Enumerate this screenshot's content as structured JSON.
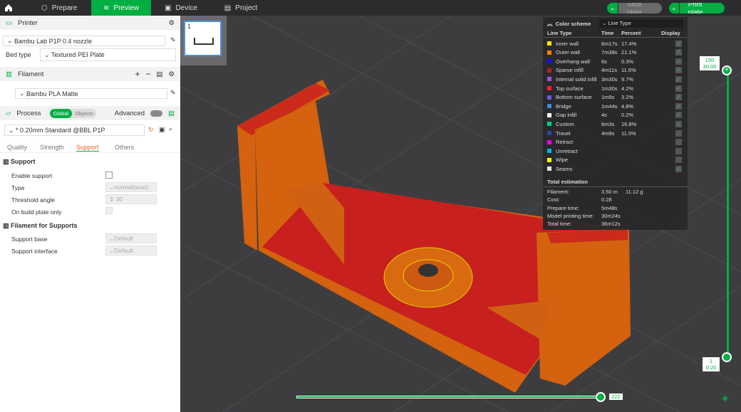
{
  "tabs": [
    {
      "label": "Prepare",
      "icon": "cube-icon"
    },
    {
      "label": "Preview",
      "icon": "layers-icon",
      "active": true
    },
    {
      "label": "Device",
      "icon": "device-icon"
    },
    {
      "label": "Project",
      "icon": "project-icon"
    }
  ],
  "actions": {
    "slice": "Slice plate",
    "print": "Print plate"
  },
  "printer": {
    "title": "Printer",
    "name": "Bambu Lab P1P 0.4 nozzle",
    "bed_label": "Bed type",
    "bed": "Textured PEI Plate"
  },
  "filament": {
    "title": "Filament",
    "name": "Bambu PLA Matte"
  },
  "process": {
    "title": "Process",
    "global": "Global",
    "objects": "Objects",
    "advanced": "Advanced",
    "preset": "* 0.20mm Standard @BBL P1P",
    "tabs": [
      "Quality",
      "Strength",
      "Support",
      "Others"
    ],
    "active_tab": "Support"
  },
  "support": {
    "title": "Support",
    "enable": "Enable support",
    "type_label": "Type",
    "type": "normal(auto)",
    "threshold_label": "Threshold angle",
    "threshold": "30",
    "build_plate": "On build plate only",
    "fil_title": "Filament for Supports",
    "base_label": "Support base",
    "base": "Default",
    "iface_label": "Support interface",
    "iface": "Default"
  },
  "plate": {
    "number": "1"
  },
  "legend": {
    "title": "Color scheme",
    "scheme": "Line Type",
    "headers": [
      "Line Type",
      "Time",
      "Percent",
      "Display"
    ],
    "rows": [
      {
        "name": "Inner wall",
        "time": "6m17s",
        "pct": "17.4%",
        "color": "#ffe600",
        "on": true
      },
      {
        "name": "Outer wall",
        "time": "7m38s",
        "pct": "21.1%",
        "color": "#ff7f00",
        "on": true
      },
      {
        "name": "Overhang wall",
        "time": "6s",
        "pct": "0.3%",
        "color": "#1010ff",
        "on": true
      },
      {
        "name": "Sparse infill",
        "time": "4m11s",
        "pct": "11.6%",
        "color": "#b41e1e",
        "on": true
      },
      {
        "name": "Internal solid infill",
        "time": "3m30s",
        "pct": "9.7%",
        "color": "#9a55d8",
        "on": true
      },
      {
        "name": "Top surface",
        "time": "1m30s",
        "pct": "4.2%",
        "color": "#ff1e28",
        "on": true
      },
      {
        "name": "Bottom surface",
        "time": "1m9s",
        "pct": "3.2%",
        "color": "#6a5ae0",
        "on": true
      },
      {
        "name": "Bridge",
        "time": "1m44s",
        "pct": "4.8%",
        "color": "#3d8ad0",
        "on": true
      },
      {
        "name": "Gap infill",
        "time": "4s",
        "pct": "0.2%",
        "color": "#ffffff",
        "on": true
      },
      {
        "name": "Custom",
        "time": "6m3s",
        "pct": "16.8%",
        "color": "#00d07a",
        "on": true
      },
      {
        "name": "Travel",
        "time": "4m9s",
        "pct": "11.5%",
        "color": "#2c44a8",
        "on": false
      },
      {
        "name": "Retract",
        "time": "",
        "pct": "",
        "color": "#f000f0",
        "on": false
      },
      {
        "name": "Unretract",
        "time": "",
        "pct": "",
        "color": "#00b4e0",
        "on": false
      },
      {
        "name": "Wipe",
        "time": "",
        "pct": "",
        "color": "#ffff00",
        "on": false
      },
      {
        "name": "Seams",
        "time": "",
        "pct": "",
        "color": "#e6e6e6",
        "on": true
      }
    ],
    "total_title": "Total estimation",
    "totals": [
      {
        "k": "Filament:",
        "v": "3.50 m",
        "v2": "11.12 g"
      },
      {
        "k": "Cost:",
        "v": "0.28"
      },
      {
        "k": "Prepare time:",
        "v": "5m48s"
      },
      {
        "k": "Model printing time:",
        "v": "30m24s"
      },
      {
        "k": "Total time:",
        "v": "36m12s"
      }
    ]
  },
  "layer_slider": {
    "top_layer": "150",
    "top_height": "30.00",
    "bottom_layer": "1",
    "bottom_height": "0.20"
  },
  "move_slider": {
    "value": "222"
  },
  "colors": {
    "accent": "#00ae42"
  }
}
